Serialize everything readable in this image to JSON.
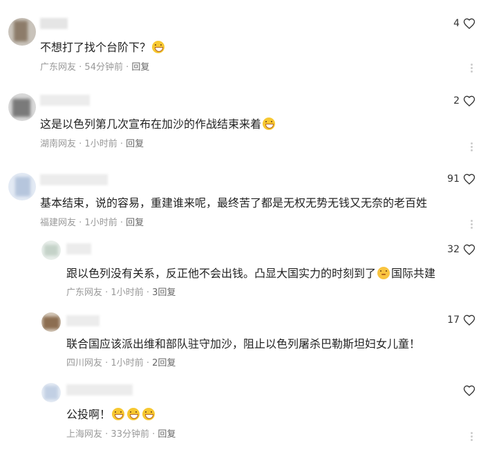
{
  "comments": [
    {
      "text": "不想打了找个台阶下？",
      "emoji_count": 1,
      "region": "广东网友",
      "time": "54分钟前",
      "reply": "回复",
      "likes": "4"
    },
    {
      "text": "这是以色列第几次宣布在加沙的作战结束来着",
      "emoji_count": 1,
      "region": "湖南网友",
      "time": "1小时前",
      "reply": "回复",
      "likes": "2"
    },
    {
      "text": "基本结束，说的容易，重建谁来呢，最终苦了都是无权无势无钱又无奈的老百姓",
      "emoji_count": 0,
      "region": "福建网友",
      "time": "1小时前",
      "reply": "回复",
      "likes": "91"
    }
  ],
  "replies": [
    {
      "text_before": "跟以色列没有关系，反正他不会出钱。凸显大国实力的时刻到了",
      "text_after": "国际共建",
      "region": "广东网友",
      "time": "1小时前",
      "reply": "3回复",
      "likes": "32"
    },
    {
      "text": "联合国应该派出维和部队驻守加沙，阻止以色列屠杀巴勒斯坦妇女儿童！",
      "region": "四川网友",
      "time": "1小时前",
      "reply": "2回复",
      "likes": "17"
    },
    {
      "text": "公投啊！",
      "emoji_count": 3,
      "region": "上海网友",
      "time": "33分钟前",
      "reply": "回复",
      "likes": ""
    }
  ],
  "separator": " · ",
  "icons": {
    "like": "heart-outline-icon",
    "more": "more-vertical-icon",
    "emoji": "laughing-emoji-icon"
  }
}
